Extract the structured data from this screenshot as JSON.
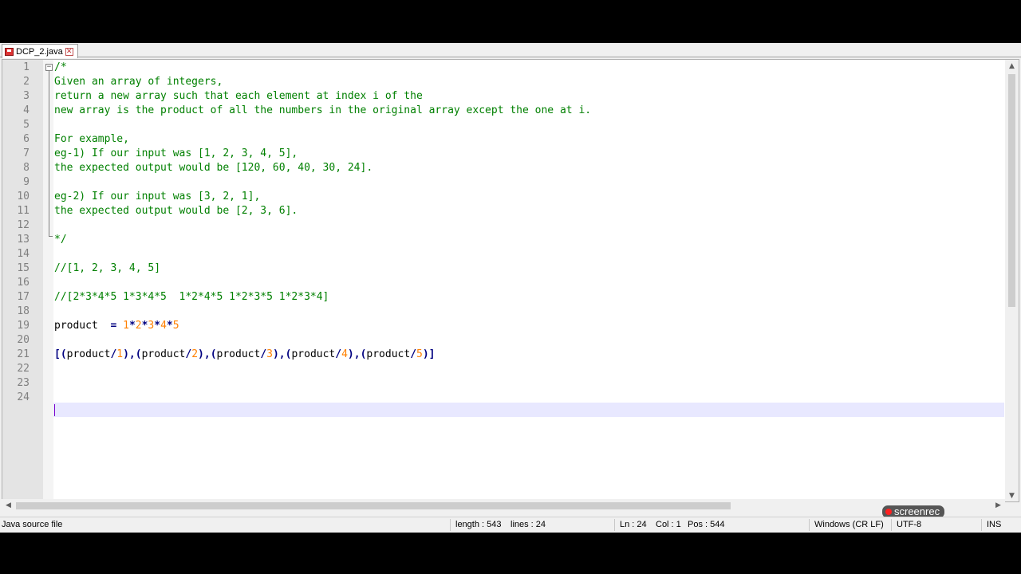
{
  "tab": {
    "label": "DCP_2.java"
  },
  "editor": {
    "lines": [
      {
        "n": "1",
        "style": "comment",
        "tokens": [
          {
            "t": "/*",
            "k": "id"
          }
        ]
      },
      {
        "n": "2",
        "style": "comment",
        "tokens": [
          {
            "t": "Given an array of integers,",
            "k": "id"
          }
        ]
      },
      {
        "n": "3",
        "style": "comment",
        "tokens": [
          {
            "t": "return a new array such that each element at index i of the",
            "k": "id"
          }
        ]
      },
      {
        "n": "4",
        "style": "comment",
        "tokens": [
          {
            "t": "new array is the product of all the numbers in the original array except the one at i.",
            "k": "id"
          }
        ]
      },
      {
        "n": "5",
        "style": "comment",
        "tokens": []
      },
      {
        "n": "6",
        "style": "comment",
        "tokens": [
          {
            "t": "For example,",
            "k": "id"
          }
        ]
      },
      {
        "n": "7",
        "style": "comment",
        "tokens": [
          {
            "t": "eg-1) If our input was [1, 2, 3, 4, 5],",
            "k": "id"
          }
        ]
      },
      {
        "n": "8",
        "style": "comment",
        "tokens": [
          {
            "t": "the expected output would be [120, 60, 40, 30, 24].",
            "k": "id"
          }
        ]
      },
      {
        "n": "9",
        "style": "comment",
        "tokens": []
      },
      {
        "n": "10",
        "style": "comment",
        "tokens": [
          {
            "t": "eg-2) If our input was [3, 2, 1],",
            "k": "id"
          }
        ]
      },
      {
        "n": "11",
        "style": "comment",
        "tokens": [
          {
            "t": "the expected output would be [2, 3, 6].",
            "k": "id"
          }
        ]
      },
      {
        "n": "12",
        "style": "comment",
        "tokens": []
      },
      {
        "n": "13",
        "style": "comment",
        "tokens": [
          {
            "t": "*/",
            "k": "id"
          }
        ]
      },
      {
        "n": "14",
        "style": "default",
        "tokens": []
      },
      {
        "n": "15",
        "style": "comment",
        "tokens": [
          {
            "t": "//[1, 2, 3, 4, 5]",
            "k": "id"
          }
        ]
      },
      {
        "n": "16",
        "style": "default",
        "tokens": []
      },
      {
        "n": "17",
        "style": "comment",
        "tokens": [
          {
            "t": "//[2*3*4*5 1*3*4*5  1*2*4*5 1*2*3*5 1*2*3*4]",
            "k": "id"
          }
        ]
      },
      {
        "n": "18",
        "style": "default",
        "tokens": []
      },
      {
        "n": "19",
        "style": "default",
        "tokens": [
          {
            "t": "product  ",
            "k": "id"
          },
          {
            "t": "=",
            "k": "op"
          },
          {
            "t": " ",
            "k": "id"
          },
          {
            "t": "1",
            "k": "num"
          },
          {
            "t": "*",
            "k": "op"
          },
          {
            "t": "2",
            "k": "num"
          },
          {
            "t": "*",
            "k": "op"
          },
          {
            "t": "3",
            "k": "num"
          },
          {
            "t": "*",
            "k": "op"
          },
          {
            "t": "4",
            "k": "num"
          },
          {
            "t": "*",
            "k": "op"
          },
          {
            "t": "5",
            "k": "num"
          }
        ]
      },
      {
        "n": "20",
        "style": "default",
        "tokens": []
      },
      {
        "n": "21",
        "style": "default",
        "tokens": [
          {
            "t": "[(",
            "k": "op"
          },
          {
            "t": "product",
            "k": "id"
          },
          {
            "t": "/",
            "k": "op"
          },
          {
            "t": "1",
            "k": "num"
          },
          {
            "t": "),(",
            "k": "op"
          },
          {
            "t": "product",
            "k": "id"
          },
          {
            "t": "/",
            "k": "op"
          },
          {
            "t": "2",
            "k": "num"
          },
          {
            "t": "),(",
            "k": "op"
          },
          {
            "t": "product",
            "k": "id"
          },
          {
            "t": "/",
            "k": "op"
          },
          {
            "t": "3",
            "k": "num"
          },
          {
            "t": "),(",
            "k": "op"
          },
          {
            "t": "product",
            "k": "id"
          },
          {
            "t": "/",
            "k": "op"
          },
          {
            "t": "4",
            "k": "num"
          },
          {
            "t": "),(",
            "k": "op"
          },
          {
            "t": "product",
            "k": "id"
          },
          {
            "t": "/",
            "k": "op"
          },
          {
            "t": "5",
            "k": "num"
          },
          {
            "t": ")]",
            "k": "op"
          }
        ]
      },
      {
        "n": "22",
        "style": "default",
        "tokens": []
      },
      {
        "n": "23",
        "style": "default",
        "tokens": []
      },
      {
        "n": "24",
        "style": "default",
        "tokens": []
      }
    ],
    "current_line": 24
  },
  "watermark": {
    "text": "screenrec"
  },
  "status": {
    "file_type": "Java source file",
    "length": "length : 543",
    "lines": "lines : 24",
    "ln": "Ln : 24",
    "col": "Col : 1",
    "pos": "Pos : 544",
    "eol": "Windows (CR LF)",
    "encoding": "UTF-8",
    "mode": "INS"
  },
  "colors": {
    "comment": "#008000",
    "operator": "#000080",
    "number": "#ff8000",
    "current_line": "#e8e8ff",
    "gutter": "#e4e4e4"
  }
}
